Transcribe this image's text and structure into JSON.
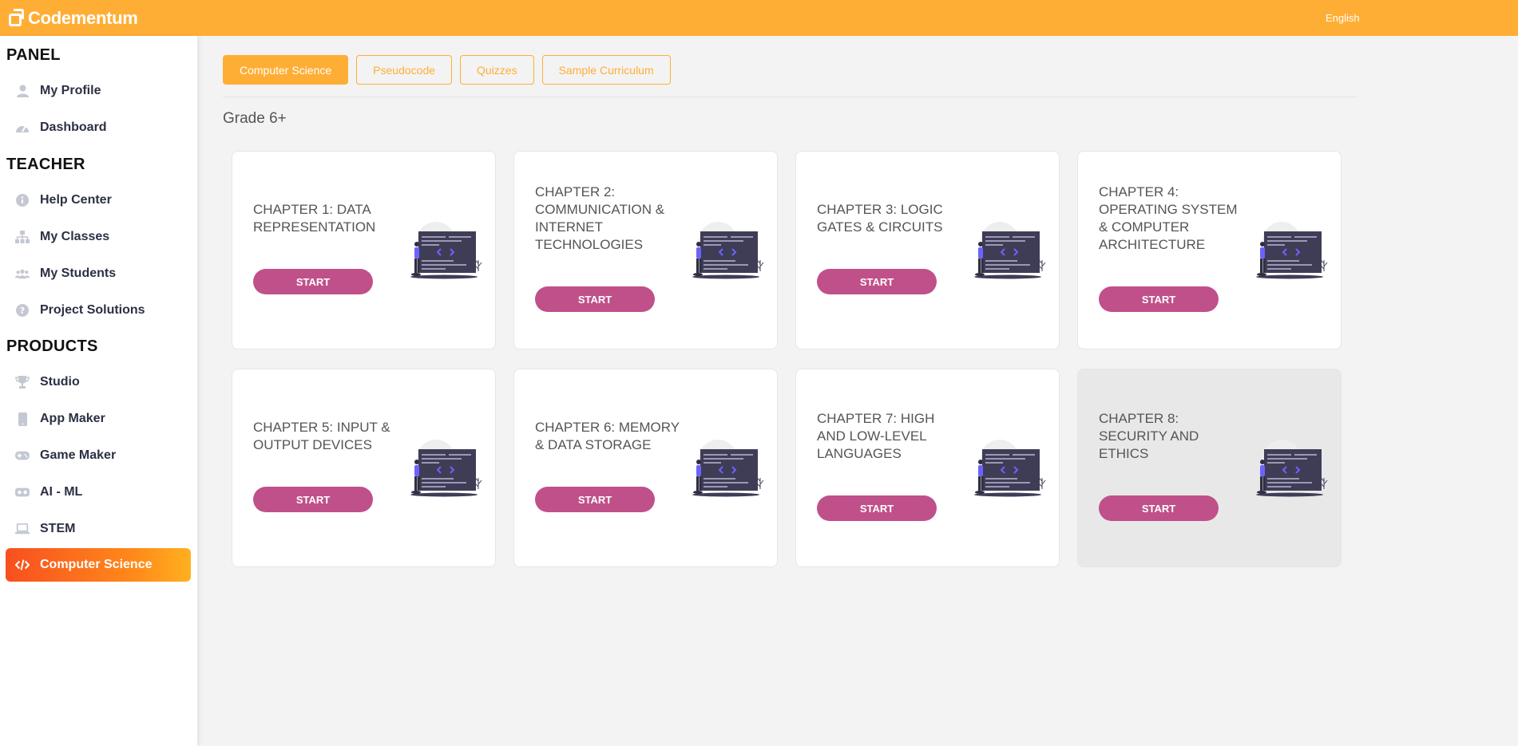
{
  "app": {
    "name": "Codementum",
    "language": "English"
  },
  "sidebar": {
    "sections": [
      {
        "title": "PANEL"
      },
      {
        "title": "TEACHER"
      },
      {
        "title": "PRODUCTS"
      }
    ],
    "items": [
      {
        "label": "My Profile",
        "icon": "user-icon"
      },
      {
        "label": "Dashboard",
        "icon": "dashboard-icon"
      },
      {
        "label": "Help Center",
        "icon": "info-icon"
      },
      {
        "label": "My Classes",
        "icon": "hierarchy-icon"
      },
      {
        "label": "My Students",
        "icon": "users-icon"
      },
      {
        "label": "Project Solutions",
        "icon": "question-icon"
      },
      {
        "label": "Studio",
        "icon": "trophy-icon"
      },
      {
        "label": "App Maker",
        "icon": "phone-icon"
      },
      {
        "label": "Game Maker",
        "icon": "gamepad-icon"
      },
      {
        "label": "AI - ML",
        "icon": "vr-icon"
      },
      {
        "label": "STEM",
        "icon": "laptop-icon"
      },
      {
        "label": "Computer Science",
        "icon": "code-icon",
        "active": true
      }
    ]
  },
  "tabs": [
    {
      "label": "Computer Science",
      "active": true
    },
    {
      "label": "Pseudocode"
    },
    {
      "label": "Quizzes"
    },
    {
      "label": "Sample Curriculum"
    }
  ],
  "grade": "Grade 6+",
  "chapters": [
    {
      "title": "CHAPTER 1: DATA REPRESENTATION",
      "button": "START"
    },
    {
      "title": "CHAPTER 2: COMMUNICATION & INTERNET TECHNOLOGIES",
      "button": "START"
    },
    {
      "title": "CHAPTER 3: LOGIC GATES & CIRCUITS",
      "button": "START"
    },
    {
      "title": "CHAPTER 4: OPERATING SYSTEM & COMPUTER ARCHITECTURE",
      "button": "START"
    },
    {
      "title": "CHAPTER 5: INPUT & OUTPUT DEVICES",
      "button": "START"
    },
    {
      "title": "CHAPTER 6: MEMORY & DATA STORAGE",
      "button": "START"
    },
    {
      "title": "CHAPTER 7: HIGH AND LOW-LEVEL LANGUAGES",
      "button": "START"
    },
    {
      "title": "CHAPTER 8: SECURITY AND ETHICS",
      "button": "START",
      "dimmed": true
    }
  ],
  "colors": {
    "accent": "#ffae35",
    "button": "#c0508a",
    "active_nav_start": "#f84f1f",
    "active_nav_end": "#ffb01f"
  }
}
